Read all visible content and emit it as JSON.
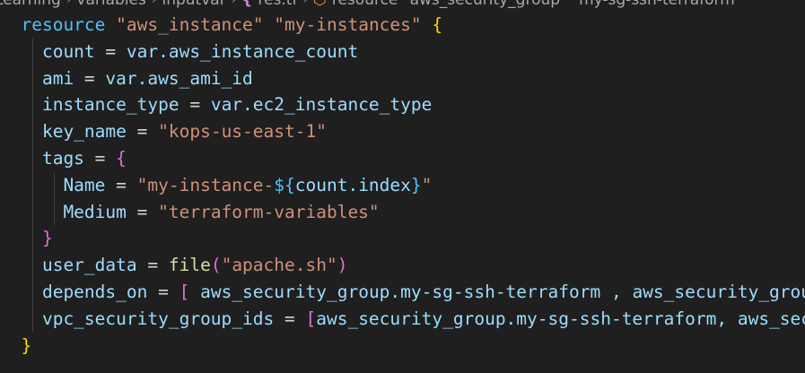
{
  "breadcrumb": {
    "items": [
      "Learning",
      "variables",
      "inputvar",
      "res.tf",
      "resource \"aws_security_group\" \"my-sg-ssh-terraform\""
    ]
  },
  "code": {
    "lines": [
      [
        {
          "t": "resource",
          "c": "kw"
        },
        {
          "t": " ",
          "c": "op"
        },
        {
          "t": "\"aws_instance\"",
          "c": "str"
        },
        {
          "t": " ",
          "c": "op"
        },
        {
          "t": "\"my-instances\"",
          "c": "str"
        },
        {
          "t": " ",
          "c": "op"
        },
        {
          "t": "{",
          "c": "b1"
        }
      ],
      [
        {
          "t": "  count",
          "c": "id"
        },
        {
          "t": " = ",
          "c": "op"
        },
        {
          "t": "var.aws_instance_count",
          "c": "id"
        }
      ],
      [
        {
          "t": "  ami",
          "c": "id"
        },
        {
          "t": " = ",
          "c": "op"
        },
        {
          "t": "var.aws_ami_id",
          "c": "id"
        }
      ],
      [
        {
          "t": "  instance_type",
          "c": "id"
        },
        {
          "t": " = ",
          "c": "op"
        },
        {
          "t": "var.ec2_instance_type",
          "c": "id"
        }
      ],
      [
        {
          "t": "  key_name",
          "c": "id"
        },
        {
          "t": " = ",
          "c": "op"
        },
        {
          "t": "\"kops-us-east-1\"",
          "c": "str"
        }
      ],
      [
        {
          "t": "  tags",
          "c": "id"
        },
        {
          "t": " = ",
          "c": "op"
        },
        {
          "t": "{",
          "c": "b2"
        }
      ],
      [
        {
          "t": "    Name",
          "c": "id"
        },
        {
          "t": " = ",
          "c": "op"
        },
        {
          "t": "\"my-instance-",
          "c": "str"
        },
        {
          "t": "${",
          "c": "kw"
        },
        {
          "t": "count.index",
          "c": "id"
        },
        {
          "t": "}",
          "c": "kw"
        },
        {
          "t": "\"",
          "c": "str"
        }
      ],
      [
        {
          "t": "    Medium",
          "c": "id"
        },
        {
          "t": " = ",
          "c": "op"
        },
        {
          "t": "\"terraform-variables\"",
          "c": "str"
        }
      ],
      [
        {
          "t": "  ",
          "c": "op"
        },
        {
          "t": "}",
          "c": "b2"
        }
      ],
      [
        {
          "t": "  user_data",
          "c": "id"
        },
        {
          "t": " = ",
          "c": "op"
        },
        {
          "t": "file",
          "c": "fn"
        },
        {
          "t": "(",
          "c": "b2"
        },
        {
          "t": "\"apache.sh\"",
          "c": "str"
        },
        {
          "t": ")",
          "c": "b2"
        }
      ],
      [
        {
          "t": "  depends_on",
          "c": "id"
        },
        {
          "t": " = ",
          "c": "op"
        },
        {
          "t": "[",
          "c": "b2"
        },
        {
          "t": " aws_security_group.my-sg-ssh-terraform , aws_security_group.my-sg-http",
          "c": "id"
        }
      ],
      [
        {
          "t": "  vpc_security_group_ids",
          "c": "id"
        },
        {
          "t": " = ",
          "c": "op"
        },
        {
          "t": "[",
          "c": "b2"
        },
        {
          "t": "aws_security_group.my-sg-ssh-terraform, aws_security_group.my-sg-http",
          "c": "id"
        }
      ],
      [
        {
          "t": "}",
          "c": "b1"
        }
      ]
    ],
    "guides": [
      [],
      [
        "g1"
      ],
      [
        "g1"
      ],
      [
        "g1"
      ],
      [
        "g1"
      ],
      [
        "g1"
      ],
      [
        "g1",
        "g2"
      ],
      [
        "g1",
        "g2"
      ],
      [
        "g1"
      ],
      [
        "g1"
      ],
      [
        "g1"
      ],
      [
        "g1"
      ],
      []
    ]
  }
}
